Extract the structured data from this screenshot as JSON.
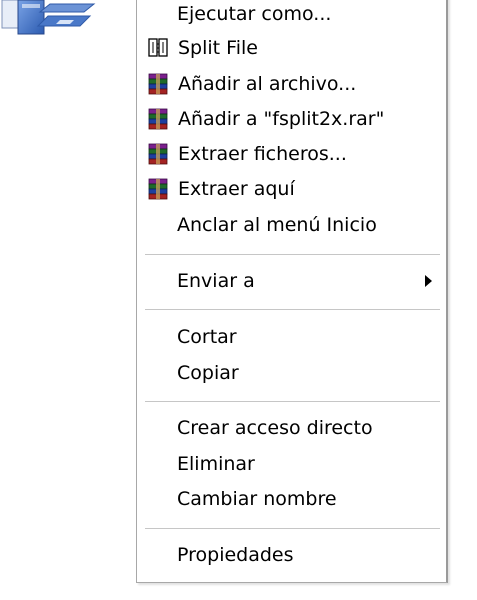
{
  "menu": {
    "items": [
      {
        "label": "Ejecutar como...",
        "icon": ""
      },
      {
        "label": "Split File",
        "icon": "split-file-icon"
      },
      {
        "label": "Añadir al archivo...",
        "icon": "winrar-icon"
      },
      {
        "label": "Añadir a \"fsplit2x.rar\"",
        "icon": "winrar-icon"
      },
      {
        "label": "Extraer ficheros...",
        "icon": "winrar-icon"
      },
      {
        "label": "Extraer aquí",
        "icon": "winrar-icon"
      },
      {
        "label": "Anclar al menú Inicio",
        "icon": ""
      },
      {
        "label": "Enviar a",
        "icon": "",
        "submenu": true
      },
      {
        "label": "Cortar",
        "icon": ""
      },
      {
        "label": "Copiar",
        "icon": ""
      },
      {
        "label": "Crear acceso directo",
        "icon": ""
      },
      {
        "label": "Eliminar",
        "icon": ""
      },
      {
        "label": "Cambiar nombre",
        "icon": ""
      },
      {
        "label": "Propiedades",
        "icon": ""
      }
    ]
  },
  "colors": {
    "menu_background": "#ffffff",
    "menu_border": "#a8a8a8",
    "separator": "#c6c6c6",
    "text": "#000000",
    "desktop_icon_blue": "#4a78c8"
  }
}
